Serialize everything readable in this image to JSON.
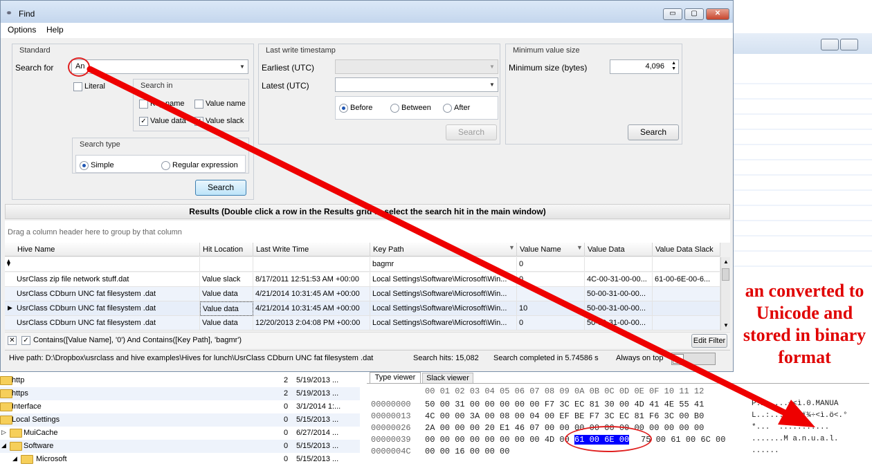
{
  "window": {
    "title": "Find",
    "btn_min": "▭",
    "btn_max": "▢",
    "btn_close": "✕"
  },
  "menu": [
    "Options",
    "Help"
  ],
  "standard": {
    "title": "Standard",
    "search_for_label": "Search for",
    "search_for_value": "An",
    "literal_label": "Literal",
    "search_in": {
      "title": "Search in",
      "key_name": "Key name",
      "value_name": "Value name",
      "value_data": "Value data",
      "value_slack": "Value slack"
    },
    "search_type": {
      "title": "Search type",
      "simple": "Simple",
      "regex": "Regular expression"
    },
    "search_button": "Search"
  },
  "timestamp": {
    "title": "Last write timestamp",
    "earliest_label": "Earliest (UTC)",
    "latest_label": "Latest (UTC)",
    "before": "Before",
    "between": "Between",
    "after": "After",
    "search_button": "Search"
  },
  "minsize": {
    "title": "Minimum value size",
    "label": "Minimum size (bytes)",
    "value": "4,096",
    "search_button": "Search"
  },
  "results": {
    "header": "Results (Double click a row in the Results grid to select the search hit in the main window)",
    "group_hint": "Drag a column header here to group by that column",
    "columns": [
      "Hive Name",
      "Hit Location",
      "Last Write Time",
      "Key Path",
      "Value Name",
      "Value Data",
      "Value Data Slack"
    ],
    "filter_row": {
      "key_path": "bagmr",
      "value_name": "0"
    },
    "rows": [
      [
        "UsrClass zip file network stuff.dat",
        "Value slack",
        "8/17/2011 12:51:53 AM +00:00",
        "Local Settings\\Software\\Microsoft\\Win...",
        "0",
        "4C-00-31-00-00...",
        "61-00-6E-00-6..."
      ],
      [
        "UsrClass CDburn UNC fat filesystem .dat",
        "Value data",
        "4/21/2014 10:31:45 AM +00:00",
        "Local Settings\\Software\\Microsoft\\Win...",
        "",
        "50-00-31-00-00...",
        ""
      ],
      [
        "UsrClass CDburn UNC fat filesystem .dat",
        "Value data",
        "4/21/2014 10:31:45 AM +00:00",
        "Local Settings\\Software\\Microsoft\\Win...",
        "10",
        "50-00-31-00-00...",
        ""
      ],
      [
        "UsrClass CDburn UNC fat filesystem .dat",
        "Value data",
        "12/20/2013 2:04:08 PM +00:00",
        "Local Settings\\Software\\Microsoft\\Win...",
        "0",
        "50-00-31-00-00...",
        ""
      ]
    ],
    "filter_text": "Contains([Value Name], '0') And Contains([Key Path], 'bagmr')",
    "edit_filter": "Edit Filter"
  },
  "status": {
    "hive_path": "Hive path: D:\\Dropbox\\usrclass and hive examples\\Hives for lunch\\UsrClass CDburn UNC fat filesystem .dat",
    "hits": "Search hits: 15,082",
    "completed": "Search completed in 5.74586 s",
    "always_on_top": "Always on top"
  },
  "tree": [
    {
      "name": "http",
      "count": "2",
      "date": "5/19/2013 ..."
    },
    {
      "name": "https",
      "count": "2",
      "date": "5/19/2013 ..."
    },
    {
      "name": "Interface",
      "count": "0",
      "date": "3/1/2014 1:..."
    },
    {
      "name": "Local Settings",
      "count": "0",
      "date": "5/15/2013 ..."
    },
    {
      "name": "MuiCache",
      "count": "0",
      "date": "6/27/2014 ..."
    },
    {
      "name": "Software",
      "count": "0",
      "date": "5/15/2013 ..."
    },
    {
      "name": "Microsoft",
      "count": "0",
      "date": "5/15/2013 ..."
    }
  ],
  "hexview": {
    "tabs": [
      "Type viewer",
      "Slack viewer"
    ],
    "header": "00 01 02 03 04 05 06 07 08 09 0A 0B 0C 0D 0E 0F 10 11 12",
    "offsets": [
      "00000000",
      "00000013",
      "00000026",
      "00000039",
      "0000004C"
    ],
    "lines": [
      "50 00 31 00 00 00 00 00 F7 3C EC 81 30 00 4D 41 4E 55 41",
      "4C 00 00 3A 00 08 00 04 00 EF BE F7 3C EC 81 F6 3C 00 B0",
      "2A 00 00 00 20 E1 46 07 00 00 00 00 00 00 00 00 00 00 00",
      "00 00 00 00 00 00 00 00 4D 00",
      "00 00 16 00 00 00"
    ],
    "selected": "61 00 6E 00",
    "after_sel": "75 00 61 00 6C 00",
    "ascii": [
      "P.1.....÷<ì.0.MANUA",
      "L..:.......ï¾÷<ì.ö<.°",
      "*...  ...........",
      ".......M a.n.u.a.l.",
      "......"
    ]
  },
  "annotation": "an converted to Unicode and stored in binary format"
}
